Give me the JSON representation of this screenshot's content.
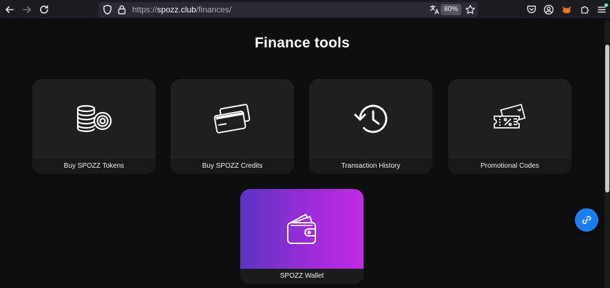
{
  "browser": {
    "url_scheme": "https://",
    "url_host": "spozz.club",
    "url_path": "/finances/",
    "zoom": "80%"
  },
  "page": {
    "title": "Finance tools"
  },
  "cards": [
    {
      "label": "Buy SPOZZ Tokens",
      "icon": "coins-icon"
    },
    {
      "label": "Buy SPOZZ Credits",
      "icon": "credit-cards-icon"
    },
    {
      "label": "Transaction History",
      "icon": "history-icon"
    },
    {
      "label": "Promotional Codes",
      "icon": "tickets-icon"
    },
    {
      "label": "SPOZZ Wallet",
      "icon": "wallet-icon"
    }
  ],
  "colors": {
    "background": "#0e0e0e",
    "card": "#1f1f1f",
    "wallet_gradient_start": "#5a34c2",
    "wallet_gradient_end": "#c22ae6",
    "fab": "#1a7ef0"
  }
}
